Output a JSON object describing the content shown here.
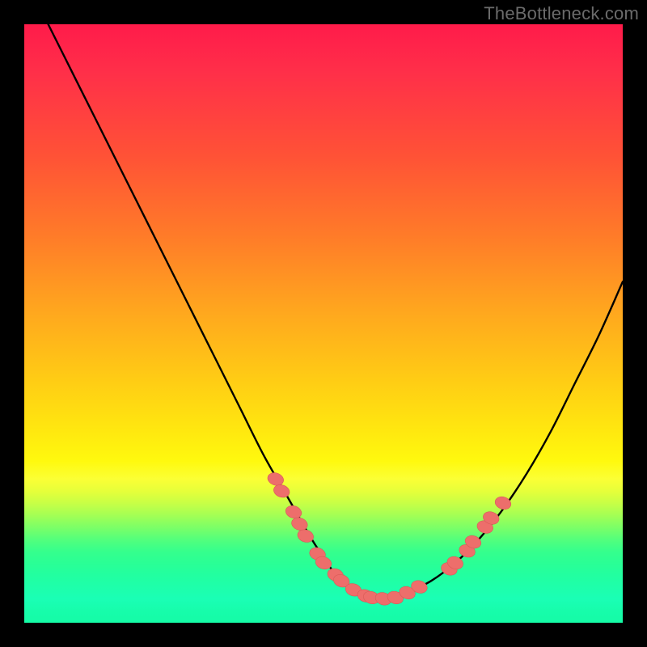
{
  "watermark": "TheBottleneck.com",
  "colors": {
    "frame": "#000000",
    "curve": "#000000",
    "marker": "#ed6e6b",
    "marker_edge": "#d95b57"
  },
  "chart_data": {
    "type": "line",
    "title": "",
    "xlabel": "",
    "ylabel": "",
    "xlim": [
      0,
      100
    ],
    "ylim": [
      0,
      100
    ],
    "series": [
      {
        "name": "bottleneck-curve",
        "x": [
          4,
          8,
          12,
          16,
          20,
          24,
          28,
          32,
          36,
          40,
          44,
          48,
          50,
          52,
          54,
          56,
          58,
          60,
          62,
          64,
          68,
          72,
          76,
          80,
          84,
          88,
          92,
          96,
          100
        ],
        "y": [
          100,
          92,
          84,
          76,
          68,
          60,
          52,
          44,
          36,
          28,
          21,
          14,
          11,
          8,
          6,
          5,
          4,
          4,
          4,
          5,
          7,
          10,
          14,
          19,
          25,
          32,
          40,
          48,
          57
        ]
      }
    ],
    "markers": {
      "name": "highlight-dots",
      "points": [
        {
          "x": 42,
          "y": 24
        },
        {
          "x": 43,
          "y": 22
        },
        {
          "x": 45,
          "y": 18.5
        },
        {
          "x": 46,
          "y": 16.5
        },
        {
          "x": 47,
          "y": 14.5
        },
        {
          "x": 49,
          "y": 11.5
        },
        {
          "x": 50,
          "y": 10
        },
        {
          "x": 52,
          "y": 8
        },
        {
          "x": 53,
          "y": 7
        },
        {
          "x": 55,
          "y": 5.5
        },
        {
          "x": 57,
          "y": 4.5
        },
        {
          "x": 58,
          "y": 4.2
        },
        {
          "x": 60,
          "y": 4
        },
        {
          "x": 62,
          "y": 4.2
        },
        {
          "x": 64,
          "y": 5
        },
        {
          "x": 66,
          "y": 6
        },
        {
          "x": 71,
          "y": 9
        },
        {
          "x": 72,
          "y": 10
        },
        {
          "x": 74,
          "y": 12
        },
        {
          "x": 75,
          "y": 13.5
        },
        {
          "x": 77,
          "y": 16
        },
        {
          "x": 78,
          "y": 17.5
        },
        {
          "x": 80,
          "y": 20
        }
      ]
    }
  }
}
